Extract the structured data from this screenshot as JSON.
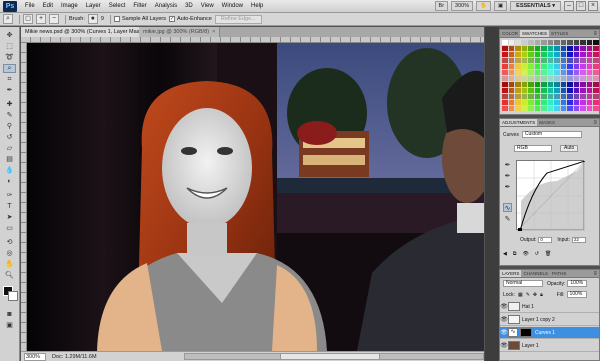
{
  "app": {
    "logo": "Ps"
  },
  "menu": [
    "File",
    "Edit",
    "Image",
    "Layer",
    "Select",
    "Filter",
    "Analysis",
    "3D",
    "View",
    "Window",
    "Help"
  ],
  "menubar_right": {
    "zoom": "300%",
    "workspace": "ESSENTIALS ▾"
  },
  "options": {
    "brush_label": "Brush:",
    "brush_size": "9",
    "sample_all_layers": "Sample All Layers",
    "auto_enhance": "Auto-Enhance",
    "refine_edge": "Refine Edge..."
  },
  "tabs": [
    {
      "label": "Mikie news.psd @ 300% (Curves 1, Layer Mask/8) *",
      "active": true
    },
    {
      "label": "mikie.jpg @ 300% (RGB/8)",
      "active": false
    }
  ],
  "status": {
    "zoom": "300%",
    "doc": "Doc: 1.29M/11.6M"
  },
  "swatches_panel": {
    "tabs": [
      "COLOR",
      "SWATCHES",
      "STYLES"
    ],
    "active": "SWATCHES"
  },
  "adjustments_panel": {
    "tabs": [
      "ADJUSTMENTS",
      "MASKS"
    ],
    "type_label": "Curves",
    "preset": "Custom",
    "channel": "RGB",
    "auto_label": "Auto",
    "output_label": "Output:",
    "output_value": "0",
    "input_label": "Input:",
    "input_value": "22"
  },
  "layers_panel": {
    "tabs": [
      "LAYERS",
      "CHANNELS",
      "PATHS"
    ],
    "blend_mode": "Normal",
    "opacity_label": "Opacity:",
    "opacity_value": "100%",
    "lock_label": "Lock:",
    "fill_label": "Fill:",
    "fill_value": "100%",
    "layers": [
      {
        "name": "Hat 1",
        "selected": false,
        "kind": "layer"
      },
      {
        "name": "Layer 1 copy 2",
        "selected": false,
        "kind": "layer"
      },
      {
        "name": "Curves 1",
        "selected": true,
        "kind": "adjustment"
      },
      {
        "name": "Layer 1",
        "selected": false,
        "kind": "layer"
      }
    ]
  }
}
